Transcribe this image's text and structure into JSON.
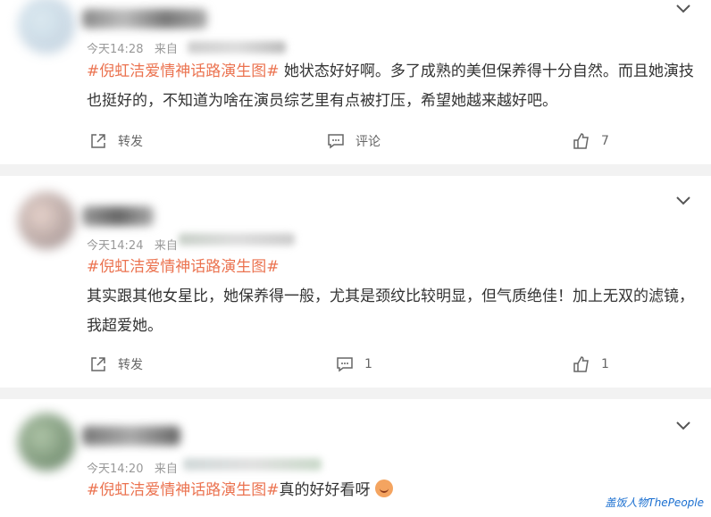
{
  "comments": [
    {
      "time": "今天14:28",
      "from_prefix": "来自",
      "hashtag": "#倪虹洁爱情神话路演生图#",
      "text": " 她状态好好啊。多了成熟的美但保养得十分自然。而且她演技也挺好的，不知道为啥在演员综艺里有点被打压，希望她越来越好吧。",
      "repost_label": "转发",
      "comment_label": "评论",
      "like_count": "7"
    },
    {
      "time": "今天14:24",
      "from_prefix": "来自",
      "hashtag": "#倪虹洁爱情神话路演生图#",
      "text": "其实跟其他女星比，她保养得一般，尤其是颈纹比较明显，但气质绝佳！加上无双的滤镜，我超爱她。",
      "repost_label": "转发",
      "comment_count": "1",
      "like_count": "1"
    },
    {
      "time": "今天14:20",
      "from_prefix": "来自",
      "hashtag": "#倪虹洁爱情神话路演生图#",
      "text": "真的好好看呀"
    }
  ],
  "watermark": "盖饭人物ThePeople",
  "colors": {
    "hashtag": "#eb7350",
    "separator": "#f2f2f2"
  }
}
